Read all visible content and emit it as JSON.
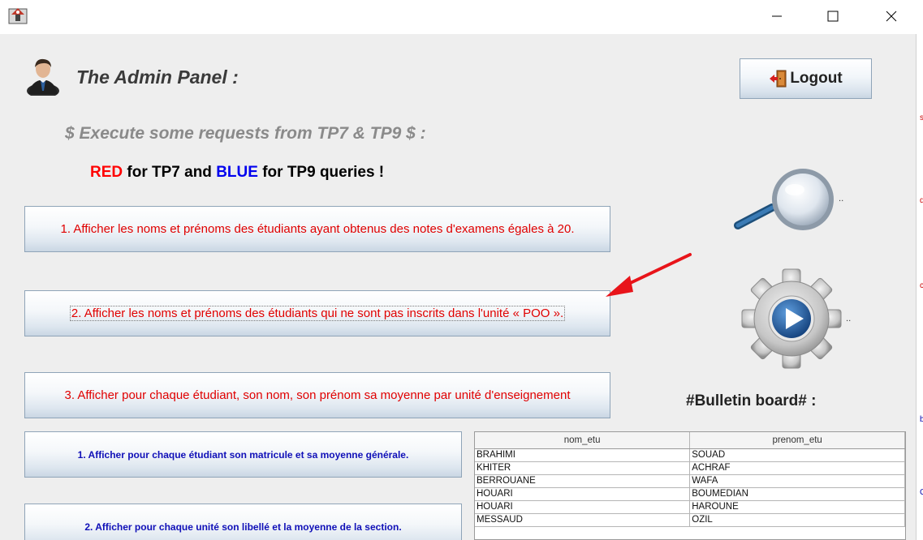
{
  "window": {
    "controls": [
      "minimize-icon",
      "maximize-icon",
      "close-icon"
    ]
  },
  "header": {
    "title": "The Admin Panel  :",
    "subtitle": "$  Execute some requests from TP7 & TP9 $ :",
    "legend": {
      "red_word": "RED",
      "red_text": " for TP7 and ",
      "blue_word": "BLUE",
      "blue_text": " for TP9 queries !"
    }
  },
  "logout": {
    "label": "Logout",
    "icon": "door-exit-icon"
  },
  "buttons": {
    "tp7": [
      "1. Afficher les noms et prénoms des étudiants ayant obtenus des notes d'examens égales à 20.",
      "2. Afficher les noms et prénoms des étudiants qui ne sont pas inscrits dans l'unité « POO ».",
      "3. Afficher pour chaque étudiant, son nom, son prénom sa moyenne par unité d'enseignement"
    ],
    "tp9": [
      "1. Afficher pour chaque étudiant son matricule et sa moyenne générale.",
      "2. Afficher pour chaque unité son libellé et la moyenne de la section."
    ]
  },
  "side": {
    "search_dots": "..",
    "execute_dots": "..",
    "board_title": "#Bulletin board# :"
  },
  "table": {
    "columns": [
      "nom_etu",
      "prenom_etu"
    ],
    "rows": [
      [
        "BRAHIMI",
        "SOUAD"
      ],
      [
        "KHITER",
        "ACHRAF"
      ],
      [
        "BERROUANE",
        "WAFA"
      ],
      [
        "HOUARI",
        "BOUMEDIAN"
      ],
      [
        "HOUARI",
        "HAROUNE"
      ],
      [
        "MESSAUD",
        "OZIL"
      ]
    ]
  },
  "colors": {
    "tp7": "#e00000",
    "tp9": "#1010b8",
    "accent_arrow": "#e8141a"
  }
}
